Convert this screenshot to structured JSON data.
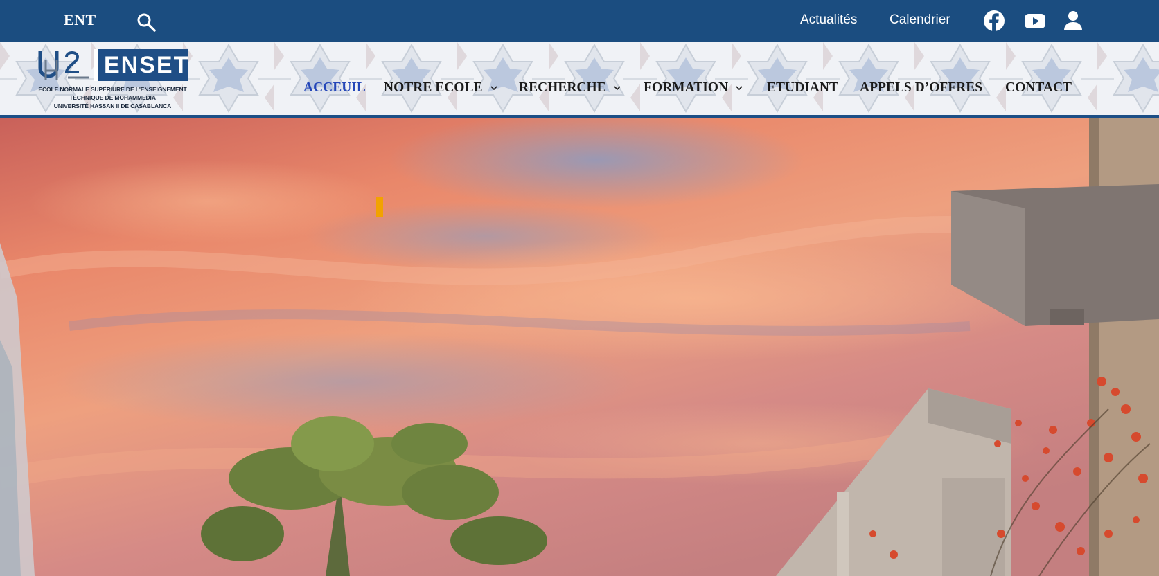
{
  "topbar": {
    "ent_label": "ENT",
    "search_icon": "search-icon",
    "links": {
      "actualites": "Actualités",
      "calendrier": "Calendrier"
    },
    "social_icons": [
      "facebook-icon",
      "youtube-icon",
      "user-icon"
    ],
    "background_color": "#1b4d80"
  },
  "logo": {
    "name": "ENSET",
    "line1": "ECOLE NORMALE SUPÉRIURE DE L'ENSEIGNEMENT",
    "line2": "TECHNIQUE DE MOHAMMEDIA",
    "line3": "UNIVERSITÉ HASSAN II DE CASABLANCA"
  },
  "nav": {
    "items": [
      {
        "label": "ACCEUIL",
        "active": true,
        "dropdown": false
      },
      {
        "label": "NOTRE ECOLE",
        "active": false,
        "dropdown": true
      },
      {
        "label": "RECHERCHE",
        "active": false,
        "dropdown": true
      },
      {
        "label": "FORMATION",
        "active": false,
        "dropdown": true
      },
      {
        "label": "ETUDIANT",
        "active": false,
        "dropdown": false
      },
      {
        "label": "APPELS D’OFFRES",
        "active": false,
        "dropdown": false
      },
      {
        "label": "CONTACT",
        "active": false,
        "dropdown": false
      }
    ],
    "active_color": "#2446b8",
    "underline_color": "#1d4f86"
  },
  "hero": {
    "image": "sunset-sky-campus-photo",
    "marker_color": "#f2a200"
  }
}
